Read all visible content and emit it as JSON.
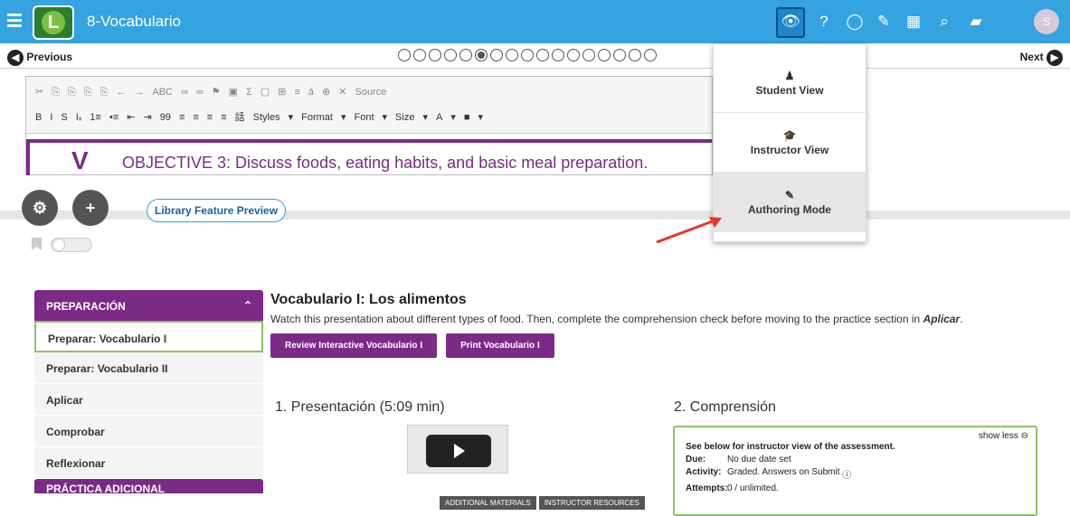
{
  "topbar": {
    "title": "8-Vocabulario",
    "logo_letter": "L",
    "avatar_letter": "S",
    "icons": [
      "menu-icon",
      "eye-icon",
      "help-icon",
      "chat-icon",
      "edit-icon",
      "calendar-icon",
      "search-icon",
      "notebook-icon"
    ]
  },
  "nav": {
    "previous": "Previous",
    "next": "Next",
    "active_page": 6,
    "page_count": 17
  },
  "editor": {
    "row1": [
      "✂",
      "⎘",
      "⎘",
      "⎘",
      "⎘",
      "←",
      "→",
      "ABC",
      "∞",
      "∞",
      "⚑",
      "▣",
      "Σ",
      "▢",
      "⊞",
      "≡",
      "á",
      "⊕",
      "✕",
      "Source"
    ],
    "row2": [
      "B",
      "I",
      "S",
      "Iₓ",
      "1≡",
      "•≡",
      "⇤",
      "⇥",
      "99",
      "≡",
      "≡",
      "≡",
      "≡",
      "話",
      "Styles",
      "▾",
      "Format",
      "▾",
      "Font",
      "▾",
      "Size",
      "▾",
      "A",
      "▾",
      "■",
      "▾"
    ],
    "objective_letter": "V",
    "objective": "OBJECTIVE 3: Discuss foods, eating habits, and basic meal preparation."
  },
  "library_button": "Library Feature Preview",
  "dropdown": {
    "items": [
      {
        "label": "Student View",
        "icon": "user-icon",
        "glyph": "♟"
      },
      {
        "label": "Instructor View",
        "icon": "graduation-cap-icon",
        "glyph": "🎓"
      },
      {
        "label": "Authoring Mode",
        "icon": "edit-icon",
        "glyph": "✎"
      }
    ]
  },
  "sidebar": {
    "section1": "PREPARACIÓN",
    "items": [
      "Preparar: Vocabulario I",
      "Preparar: Vocabulario II",
      "Aplicar",
      "Comprobar",
      "Reflexionar"
    ],
    "section2": "PRÁCTICA ADICIONAL"
  },
  "main": {
    "title": "Vocabulario I: Los alimentos",
    "desc": "Watch this presentation about different types of food. Then, complete the comprehension check before moving to the practice section in",
    "desc_link": "Aplicar",
    "buttons": [
      "Review Interactive Vocabulario I",
      "Print Vocabulario I"
    ],
    "section1": "1. Presentación (5:09 min)",
    "section2": "2. Comprensión",
    "chips": [
      "Additional Materials",
      "Instructor Resources"
    ]
  },
  "assessment": {
    "show_less": "show less",
    "heading": "See below for instructor view of the assessment.",
    "rows": [
      {
        "k": "Due:",
        "v": "No due date set"
      },
      {
        "k": "Activity:",
        "v": "Graded. Answers on Submit"
      },
      {
        "k": "Attempts:",
        "v": "0 / unlimited."
      }
    ]
  }
}
